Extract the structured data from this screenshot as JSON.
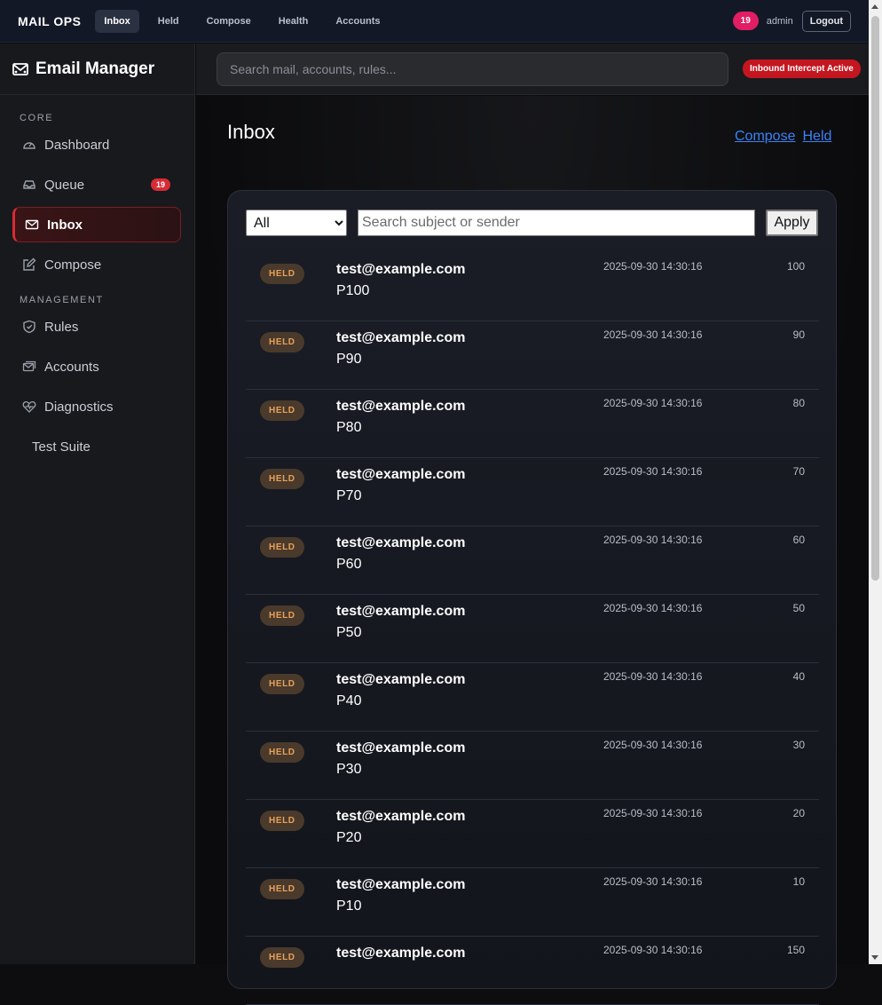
{
  "topnav": {
    "brand": "MAIL OPS",
    "links": [
      "Inbox",
      "Held",
      "Compose",
      "Health",
      "Accounts"
    ],
    "active_index": 0,
    "count": "19",
    "user": "admin",
    "logout_label": "Logout"
  },
  "sidebar": {
    "title": "Email Manager",
    "core_label": "CORE",
    "core_items": [
      {
        "label": "Dashboard",
        "icon": "gauge-icon"
      },
      {
        "label": "Queue",
        "icon": "inbox-tray-icon",
        "badge": "19"
      },
      {
        "label": "Inbox",
        "icon": "envelope-icon",
        "active": true
      },
      {
        "label": "Compose",
        "icon": "pencil-square-icon"
      }
    ],
    "management_label": "MANAGEMENT",
    "management_items": [
      {
        "label": "Rules",
        "icon": "shield-icon"
      },
      {
        "label": "Accounts",
        "icon": "envelope-stack-icon"
      },
      {
        "label": "Diagnostics",
        "icon": "heart-pulse-icon"
      },
      {
        "label": "Test Suite",
        "icon": ""
      }
    ]
  },
  "search": {
    "placeholder": "Search mail, accounts, rules...",
    "status_badge": "Inbound Intercept Active"
  },
  "main": {
    "title": "Inbox",
    "links": [
      "Compose",
      "Held"
    ],
    "filter": {
      "selected": "All",
      "search_placeholder": "Search subject or sender",
      "apply_label": "Apply"
    },
    "messages": [
      {
        "status": "HELD",
        "sender": "test@example.com",
        "subject": "P100",
        "timestamp": "2025-09-30 14:30:16",
        "score": "100"
      },
      {
        "status": "HELD",
        "sender": "test@example.com",
        "subject": "P90",
        "timestamp": "2025-09-30 14:30:16",
        "score": "90"
      },
      {
        "status": "HELD",
        "sender": "test@example.com",
        "subject": "P80",
        "timestamp": "2025-09-30 14:30:16",
        "score": "80"
      },
      {
        "status": "HELD",
        "sender": "test@example.com",
        "subject": "P70",
        "timestamp": "2025-09-30 14:30:16",
        "score": "70"
      },
      {
        "status": "HELD",
        "sender": "test@example.com",
        "subject": "P60",
        "timestamp": "2025-09-30 14:30:16",
        "score": "60"
      },
      {
        "status": "HELD",
        "sender": "test@example.com",
        "subject": "P50",
        "timestamp": "2025-09-30 14:30:16",
        "score": "50"
      },
      {
        "status": "HELD",
        "sender": "test@example.com",
        "subject": "P40",
        "timestamp": "2025-09-30 14:30:16",
        "score": "40"
      },
      {
        "status": "HELD",
        "sender": "test@example.com",
        "subject": "P30",
        "timestamp": "2025-09-30 14:30:16",
        "score": "30"
      },
      {
        "status": "HELD",
        "sender": "test@example.com",
        "subject": "P20",
        "timestamp": "2025-09-30 14:30:16",
        "score": "20"
      },
      {
        "status": "HELD",
        "sender": "test@example.com",
        "subject": "P10",
        "timestamp": "2025-09-30 14:30:16",
        "score": "10"
      },
      {
        "status": "HELD",
        "sender": "test@example.com",
        "subject": "",
        "timestamp": "2025-09-30 14:30:16",
        "score": "150"
      }
    ]
  },
  "colors": {
    "accent_red": "#d72b35",
    "link_blue": "#3b82f6",
    "held_text": "#e8a25a",
    "pill_pink": "#e11d63"
  }
}
